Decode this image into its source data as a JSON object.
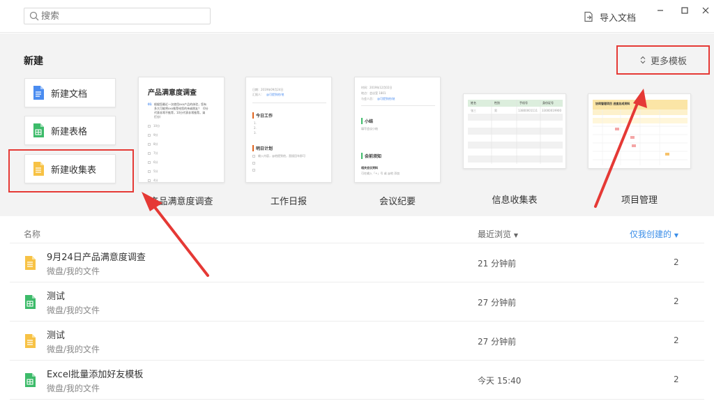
{
  "search": {
    "placeholder": "搜索"
  },
  "toolbar": {
    "import_label": "导入文档"
  },
  "new_section": {
    "title": "新建",
    "more_templates": "更多模板",
    "buttons": [
      {
        "label": "新建文档",
        "icon": "doc-blue-icon"
      },
      {
        "label": "新建表格",
        "icon": "sheet-green-icon"
      },
      {
        "label": "新建收集表",
        "icon": "form-yellow-icon"
      }
    ],
    "templates": [
      {
        "label": "产品满意度调查"
      },
      {
        "label": "工作日报"
      },
      {
        "label": "会议纪要"
      },
      {
        "label": "信息收集表"
      },
      {
        "label": "项目管理"
      }
    ]
  },
  "thumb1": {
    "title": "产品满意度调查",
    "q1a": "根据您最近一次使用xxx产品的体验，您有",
    "q1b": "多大可能将xxx推荐给您的亲戚朋友？（0分",
    "q1c": "代表非常不推荐，10分代表非常推荐。请",
    "q1d": "打分）",
    "opts": [
      "10分",
      "9分",
      "8分",
      "7分",
      "6分",
      "5分",
      "4分"
    ]
  },
  "thumb2": {
    "meta1": "日期：2019年09月24日",
    "meta2": "汇报人：",
    "meta2_link": "@可提到他/他",
    "h1": "今日工作",
    "items": [
      "1.",
      "2.",
      "3."
    ],
    "h2": "明日计划",
    "plan": "输入内容，@他提到他，直接回车即可"
  },
  "thumb3": {
    "meta1": "时间：2019年12月02日",
    "meta2": "地点：会议室 1801",
    "meta3": "与会人员：",
    "meta3_link": "@可提到他/她",
    "h1": "小结",
    "sum": "填写会议小结",
    "h2": "会前须知",
    "sub": "相关会议资料",
    "note": "可在输入「+」号 或 @他 添加"
  },
  "thumb4": {
    "headers": [
      "姓名",
      "性别",
      "手机号",
      "身份证号"
    ],
    "row": [
      "张三",
      "男",
      "13800001111",
      "33000019900"
    ]
  },
  "thumb5": {
    "title": "协同管理项目 进度总成资料"
  },
  "list": {
    "col_name": "名称",
    "col_recent": "最近浏览",
    "col_mine": "仅我创建的",
    "rows": [
      {
        "name": "9月24日产品满意度调查",
        "path": "微盘/我的文件",
        "time": "21 分钟前",
        "count": "2",
        "icon": "form-yellow-icon"
      },
      {
        "name": "测试",
        "path": "微盘/我的文件",
        "time": "27 分钟前",
        "count": "2",
        "icon": "sheet-green-icon"
      },
      {
        "name": "测试",
        "path": "微盘/我的文件",
        "time": "27 分钟前",
        "count": "2",
        "icon": "form-yellow-icon"
      },
      {
        "name": "Excel批量添加好友模板",
        "path": "微盘/我的文件",
        "time": "今天 15:40",
        "count": "2",
        "icon": "sheet-green-icon"
      }
    ]
  },
  "colors": {
    "accent_blue": "#3b8ee8",
    "doc_blue": "#4a8cf0",
    "sheet_green": "#3dbb6a",
    "form_yellow": "#f7c245",
    "highlight_red": "#e53935"
  }
}
